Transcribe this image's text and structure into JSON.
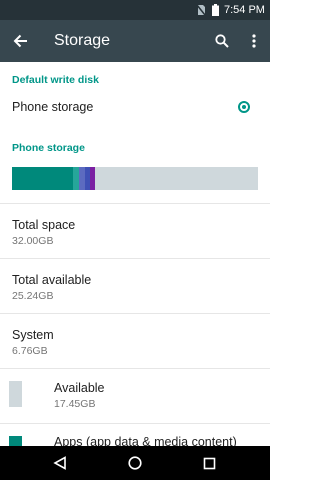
{
  "status_bar": {
    "time": "7:54 PM",
    "icons": [
      "no-sim-icon",
      "battery-icon"
    ]
  },
  "app_bar": {
    "title": "Storage",
    "back_icon": "back-arrow-icon",
    "actions": [
      "search-icon",
      "overflow-menu-icon"
    ]
  },
  "colors": {
    "status_bar": "#263238",
    "app_bar": "#37474f",
    "accent": "#009688",
    "bar_background": "#cfd8dc"
  },
  "default_write_disk": {
    "header": "Default write disk",
    "option_label": "Phone storage",
    "selected": true
  },
  "phone_storage": {
    "header": "Phone storage",
    "usage_fractions": [
      {
        "name": "apps",
        "color": "#00897b",
        "fraction": 0.247
      },
      {
        "name": "segment-2",
        "color": "#26a69a",
        "fraction": 0.024
      },
      {
        "name": "segment-3",
        "color": "#5c6bc0",
        "fraction": 0.024
      },
      {
        "name": "segment-4",
        "color": "#3f51b5",
        "fraction": 0.02
      },
      {
        "name": "segment-5",
        "color": "#7b1fa2",
        "fraction": 0.02
      }
    ]
  },
  "rows": [
    {
      "title": "Total space",
      "value": "32.00GB"
    },
    {
      "title": "Total available",
      "value": "25.24GB"
    },
    {
      "title": "System",
      "value": "6.76GB"
    }
  ],
  "legend_items": [
    {
      "title": "Available",
      "value": "17.45GB",
      "color": "#cfd8dc"
    },
    {
      "title": "Apps (app data & media content)",
      "value": "",
      "color": "#00897b"
    }
  ],
  "nav_bar": {
    "buttons": [
      "back-triangle-icon",
      "home-circle-icon",
      "recents-square-icon"
    ]
  }
}
